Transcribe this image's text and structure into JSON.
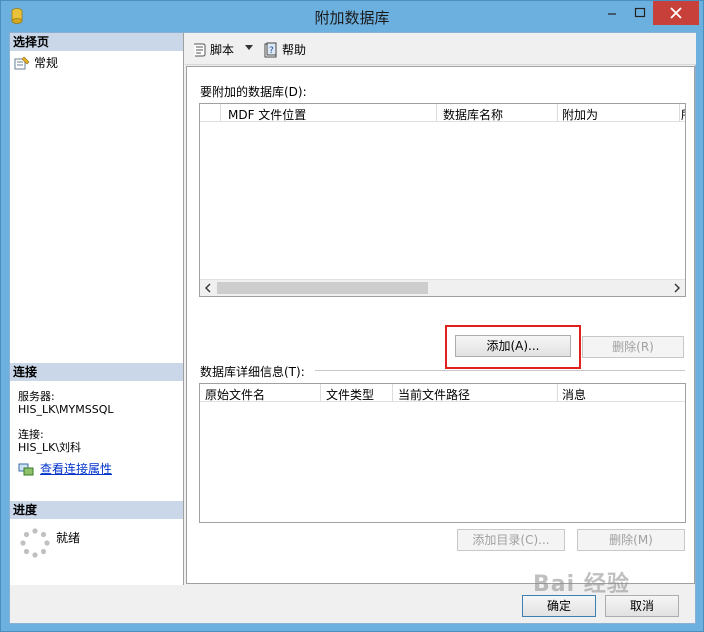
{
  "window": {
    "title": "附加数据库"
  },
  "left": {
    "select_page_header": "选择页",
    "nav_general": "常规",
    "connection_header": "连接",
    "server_label": "服务器:",
    "server_value": "HIS_LK\\MYMSSQL",
    "connection_label": "连接:",
    "connection_value": "HIS_LK\\刘科",
    "view_properties_link": "查看连接属性",
    "progress_header": "进度",
    "progress_status": "就绪"
  },
  "toolbar": {
    "script_label": "脚本",
    "help_label": "帮助"
  },
  "attach": {
    "label": "要附加的数据库(D):",
    "columns": [
      "MDF 文件位置",
      "数据库名称",
      "附加为",
      "所"
    ],
    "add_button": "添加(A)...",
    "remove_button": "删除(R)"
  },
  "details": {
    "label": "数据库详细信息(T):",
    "columns": [
      "原始文件名",
      "文件类型",
      "当前文件路径",
      "消息"
    ],
    "add_catalog_button": "添加目录(C)...",
    "remove_button": "删除(M)"
  },
  "footer": {
    "ok_button": "确定",
    "cancel_button": "取消"
  },
  "watermark": "Bai 经验"
}
